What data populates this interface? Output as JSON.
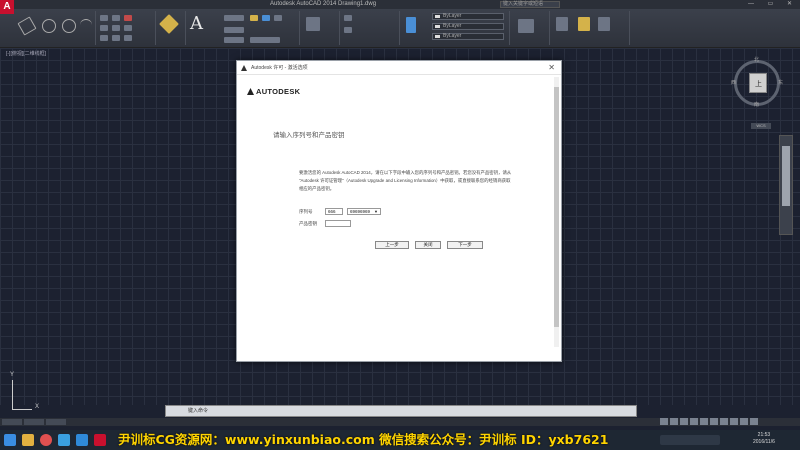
{
  "window": {
    "title": "Autodesk AutoCAD 2014    Drawing1.dwg",
    "help_search_placeholder": "键入关键字或短语",
    "controls": "— ▭ ✕"
  },
  "ribbon": {
    "text_tool_label": "A",
    "layer_value": "ByLayer",
    "color_value": "ByLayer",
    "linetype_value": "ByLayer"
  },
  "canvas": {
    "viewport_label": "[-][俯视][二维线框]",
    "viewcube": {
      "face_letter": "上",
      "north": "北",
      "south": "南",
      "west": "西",
      "east": "东",
      "wcs": "WCS"
    },
    "ucs": {
      "x_label": "X",
      "y_label": "Y"
    }
  },
  "command_line": {
    "placeholder": "键入命令"
  },
  "dialog": {
    "title": "Autodesk 许可 - 激活选项",
    "close": "✕",
    "brand": "AUTODESK",
    "heading": "请输入序列号和产品密钥",
    "description": "要激活您的 Autodesk AutoCAD 2014，请在以下字段中输入您的序列号和产品密钥。若您没有产品密钥，请从 \"Autodesk 许可证管理\"（Autodesk Upgrade and Licensing Information）中获取，或直接联系您的经销商获取相应的产品密钥。",
    "serial_label": "序列号",
    "serial_part1": "666",
    "serial_part2": "69696969",
    "product_key_label": "产品密钥",
    "product_key_value": "",
    "buttons": {
      "back": "上一步",
      "close": "关闭",
      "next": "下一步"
    }
  },
  "taskbar": {
    "watermark": "尹训标CG资源网：www.yinxunbiao.com 微信搜索公众号：尹训标 ID：yxb7621",
    "time": "21:53",
    "date": "2016/11/6"
  },
  "colors": {
    "accent_red": "#c8102e",
    "canvas_bg": "#1c2130",
    "watermark": "#ffd400"
  }
}
